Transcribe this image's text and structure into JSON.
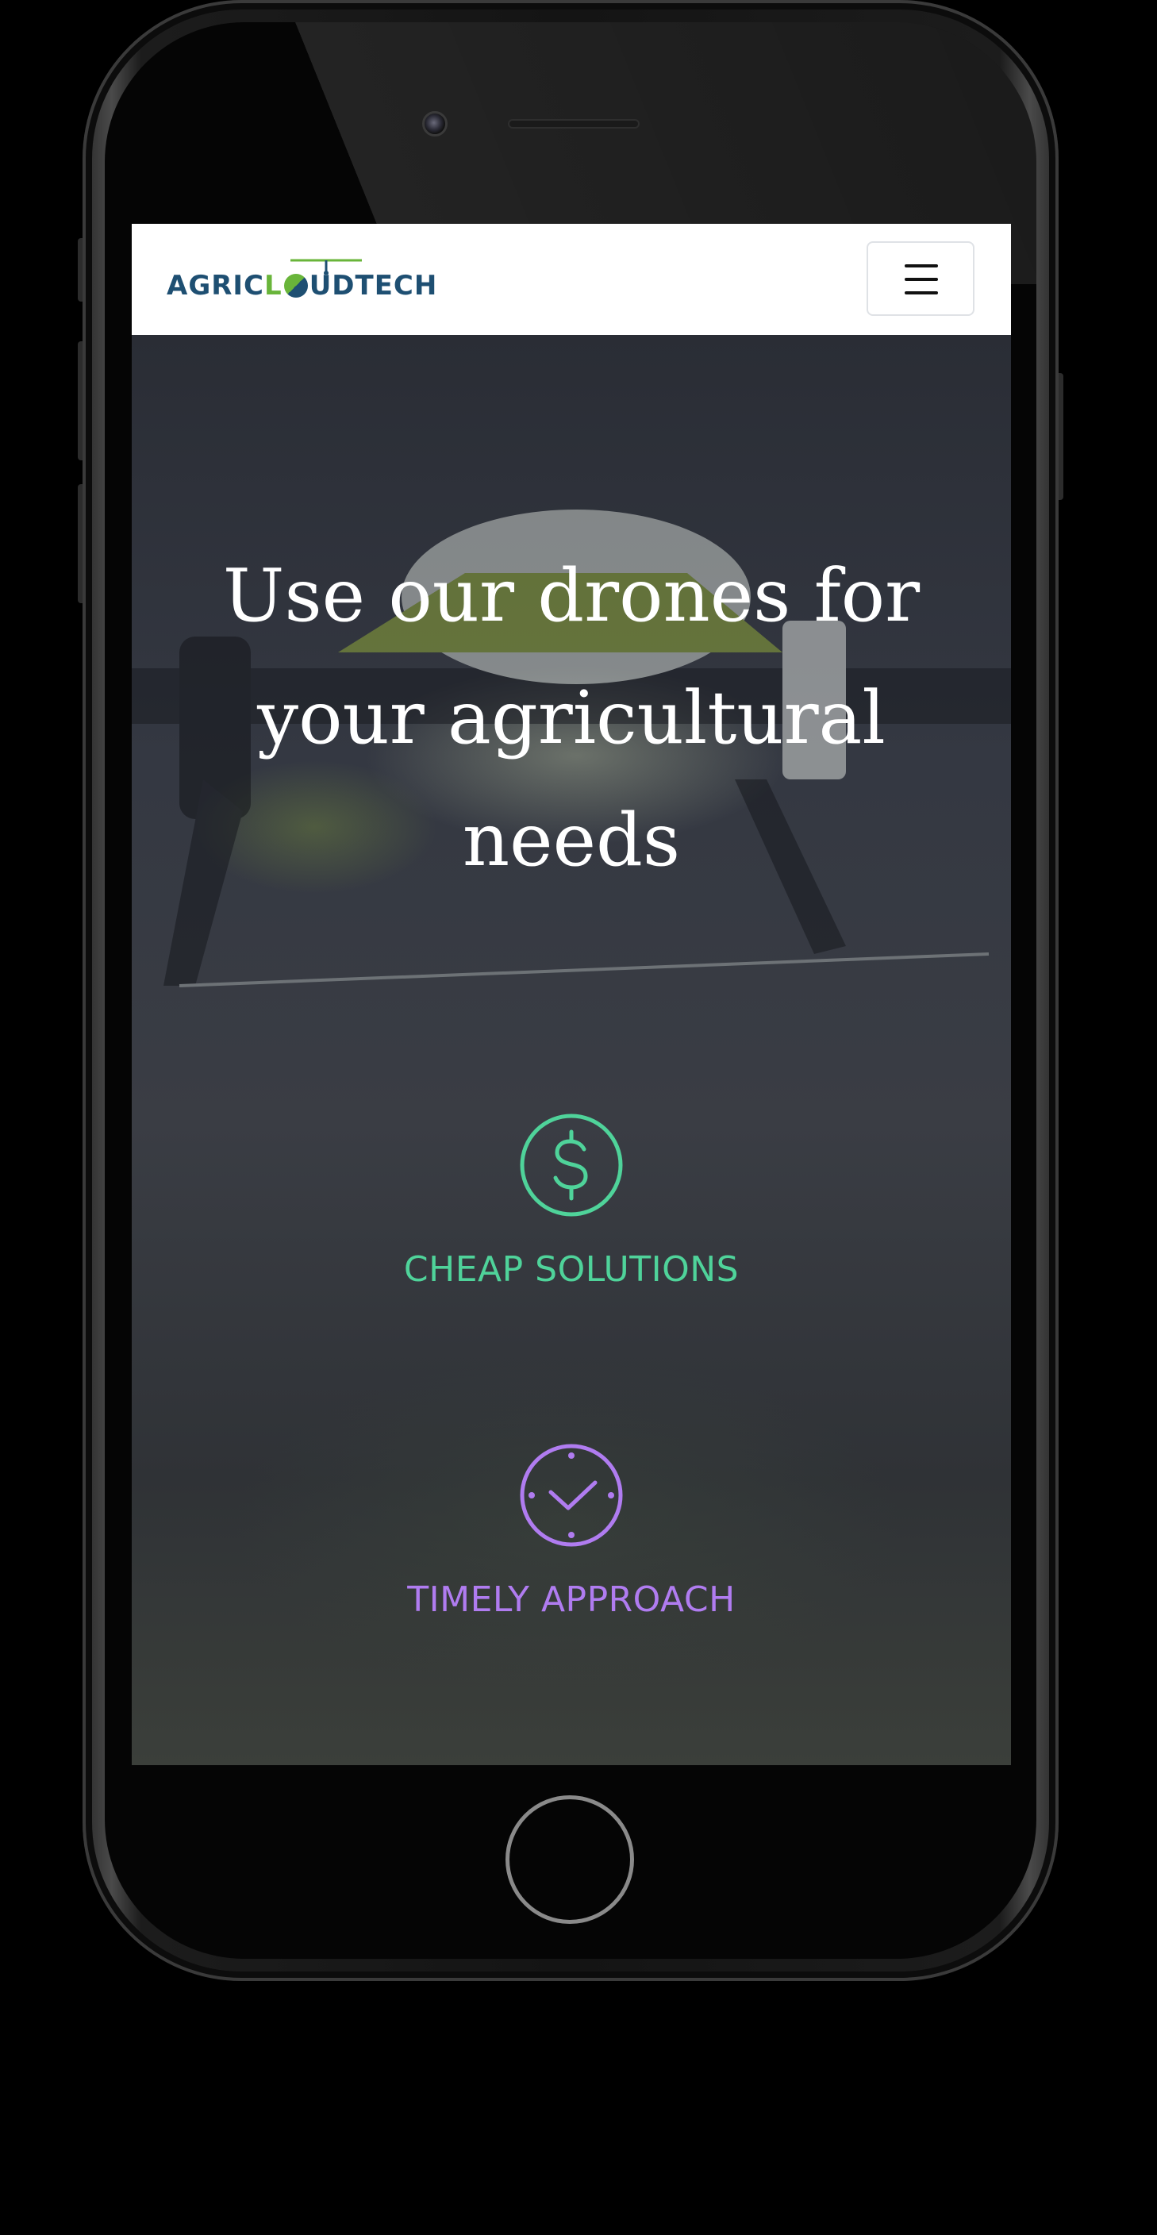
{
  "site": {
    "logo": {
      "part1": "AGRIC",
      "part2": "L",
      "part3": "UDTECH"
    },
    "menu_icon": "hamburger-menu-icon"
  },
  "hero": {
    "headline_line1": "Use our drones for",
    "headline_line2": "your agricultural",
    "headline_line3": "needs"
  },
  "features": [
    {
      "label": "CHEAP SOLUTIONS",
      "icon": "dollar-circle-icon",
      "color": "#4fd39a"
    },
    {
      "label": "TIMELY APPROACH",
      "icon": "clock-icon",
      "color": "#b07cf0"
    }
  ],
  "colors": {
    "logo_blue": "#1e4f72",
    "logo_green": "#69b53a",
    "header_bg": "#ffffff"
  }
}
